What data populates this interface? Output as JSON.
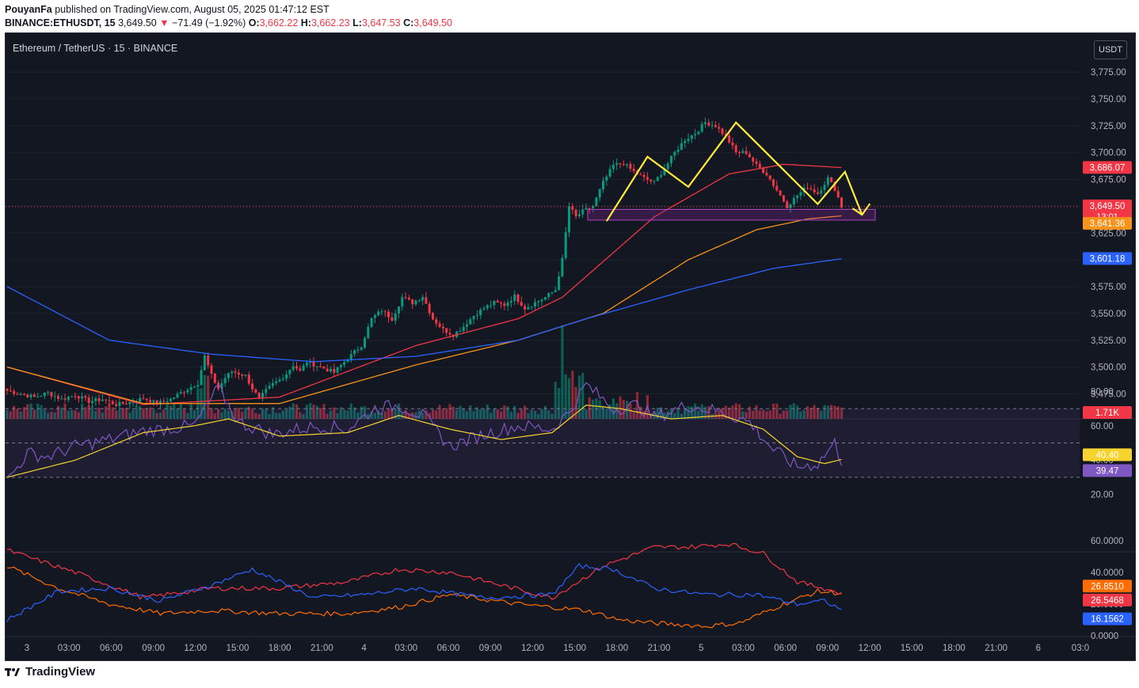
{
  "header": {
    "author": "PouyanFa",
    "published_text": "published on TradingView.com, August 05, 2025 01:47:12 EST",
    "symbol_line": "BINANCE:ETHUSDT, 15",
    "last": "3,649.50",
    "arrow": "▼",
    "change": "−71.49 (−1.92%)",
    "o_label": "O:",
    "o": "3,662.22",
    "h_label": "H:",
    "h": "3,662.23",
    "l_label": "L:",
    "l": "3,647.53",
    "c_label": "C:",
    "c": "3,649.50"
  },
  "chart": {
    "symbol_title": "Ethereum / TetherUS · 15 · BINANCE",
    "currency_button": "USDT",
    "colors": {
      "up": "#089981",
      "down": "#f23645",
      "ma_fast": "#f23645",
      "ma_mid": "#f7931a",
      "ma_slow": "#2962ff",
      "rsi": "#7e57c2",
      "rsi_ma": "#f6d32d",
      "pattern": "#ffeb3b"
    },
    "price_axis": [
      "3,775.00",
      "3,750.00",
      "3,725.00",
      "3,700.00",
      "3,675.00",
      "3,650.00",
      "3,625.00",
      "3,600.00",
      "3,575.00",
      "3,550.00",
      "3,525.00",
      "3,500.00",
      "3,475.00"
    ],
    "rsi_axis": [
      "80.00",
      "60.00",
      "40.00",
      "20.00"
    ],
    "dmi_axis": [
      "60.0000",
      "40.0000",
      "20.0000",
      "0.0000"
    ],
    "time_axis": [
      "3",
      "03:00",
      "06:00",
      "09:00",
      "12:00",
      "15:00",
      "18:00",
      "21:00",
      "4",
      "03:00",
      "06:00",
      "09:00",
      "12:00",
      "15:00",
      "18:00",
      "21:00",
      "5",
      "03:00",
      "06:00",
      "09:00",
      "12:00",
      "15:00",
      "18:00",
      "21:00",
      "6",
      "03:0"
    ],
    "price_badges": [
      {
        "label": "3,686.07",
        "color": "#f23645"
      },
      {
        "label": "3,649.50",
        "color": "#f23645",
        "sub": "13:01"
      },
      {
        "label": "3,641.36",
        "color": "#f7931a"
      },
      {
        "label": "3,601.18",
        "color": "#2962ff"
      },
      {
        "label": "1.71K",
        "color": "#f23645"
      }
    ],
    "rsi_badges": [
      {
        "label": "40.40",
        "color": "#f6d32d"
      },
      {
        "label": "39.47",
        "color": "#7e57c2"
      }
    ],
    "dmi_badges": [
      {
        "label": "26.8510",
        "color": "#ff6d00"
      },
      {
        "label": "26.5468",
        "color": "#f23645"
      },
      {
        "label": "16.1562",
        "color": "#2962ff"
      }
    ]
  },
  "chart_data": {
    "type": "candlestick",
    "title": "Ethereum / TetherUS · 15 · BINANCE",
    "ylim": [
      3462,
      3790
    ],
    "close_path": [
      [
        0,
        3478
      ],
      [
        4,
        3475
      ],
      [
        8,
        3472
      ],
      [
        12,
        3476
      ],
      [
        16,
        3470
      ],
      [
        20,
        3474
      ],
      [
        24,
        3468
      ],
      [
        28,
        3470
      ],
      [
        32,
        3465
      ],
      [
        36,
        3467
      ],
      [
        40,
        3471
      ],
      [
        44,
        3466
      ],
      [
        48,
        3470
      ],
      [
        52,
        3478
      ],
      [
        56,
        3485
      ],
      [
        58,
        3510
      ],
      [
        60,
        3492
      ],
      [
        62,
        3480
      ],
      [
        64,
        3490
      ],
      [
        66,
        3496
      ],
      [
        70,
        3492
      ],
      [
        72,
        3480
      ],
      [
        74,
        3470
      ],
      [
        76,
        3478
      ],
      [
        78,
        3484
      ],
      [
        80,
        3488
      ],
      [
        82,
        3494
      ],
      [
        84,
        3502
      ],
      [
        86,
        3496
      ],
      [
        88,
        3505
      ],
      [
        92,
        3500
      ],
      [
        96,
        3495
      ],
      [
        100,
        3508
      ],
      [
        104,
        3520
      ],
      [
        107,
        3545
      ],
      [
        110,
        3553
      ],
      [
        113,
        3545
      ],
      [
        116,
        3565
      ],
      [
        119,
        3560
      ],
      [
        122,
        3566
      ],
      [
        125,
        3545
      ],
      [
        128,
        3535
      ],
      [
        131,
        3530
      ],
      [
        134,
        3538
      ],
      [
        137,
        3548
      ],
      [
        140,
        3555
      ],
      [
        143,
        3560
      ],
      [
        146,
        3558
      ],
      [
        149,
        3566
      ],
      [
        152,
        3555
      ],
      [
        155,
        3560
      ],
      [
        158,
        3565
      ],
      [
        161,
        3572
      ],
      [
        163,
        3600
      ],
      [
        165,
        3650
      ],
      [
        167,
        3640
      ],
      [
        169,
        3645
      ],
      [
        172,
        3650
      ],
      [
        175,
        3672
      ],
      [
        178,
        3688
      ],
      [
        181,
        3690
      ],
      [
        184,
        3682
      ],
      [
        187,
        3676
      ],
      [
        190,
        3672
      ],
      [
        193,
        3685
      ],
      [
        196,
        3700
      ],
      [
        199,
        3712
      ],
      [
        202,
        3718
      ],
      [
        205,
        3728
      ],
      [
        208,
        3725
      ],
      [
        211,
        3715
      ],
      [
        214,
        3700
      ],
      [
        217,
        3700
      ],
      [
        220,
        3688
      ],
      [
        223,
        3680
      ],
      [
        226,
        3665
      ],
      [
        229,
        3650
      ],
      [
        232,
        3660
      ],
      [
        235,
        3668
      ],
      [
        238,
        3662
      ],
      [
        241,
        3676
      ],
      [
        243,
        3666
      ],
      [
        244,
        3658
      ],
      [
        245,
        3649.5
      ]
    ],
    "moving_averages": [
      {
        "name": "ma_fast",
        "color": "#f23645",
        "path": [
          [
            0,
            3500
          ],
          [
            40,
            3465
          ],
          [
            80,
            3472
          ],
          [
            120,
            3520
          ],
          [
            150,
            3545
          ],
          [
            163,
            3565
          ],
          [
            190,
            3640
          ],
          [
            212,
            3680
          ],
          [
            228,
            3689
          ],
          [
            245,
            3686
          ]
        ]
      },
      {
        "name": "ma_mid",
        "color": "#f7931a",
        "path": [
          [
            0,
            3500
          ],
          [
            40,
            3466
          ],
          [
            80,
            3466
          ],
          [
            120,
            3502
          ],
          [
            150,
            3525
          ],
          [
            175,
            3550
          ],
          [
            200,
            3600
          ],
          [
            220,
            3628
          ],
          [
            235,
            3638
          ],
          [
            245,
            3641
          ]
        ]
      },
      {
        "name": "ma_slow",
        "color": "#2962ff",
        "path": [
          [
            0,
            3575
          ],
          [
            30,
            3525
          ],
          [
            60,
            3512
          ],
          [
            90,
            3505
          ],
          [
            120,
            3510
          ],
          [
            150,
            3525
          ],
          [
            170,
            3545
          ],
          [
            200,
            3572
          ],
          [
            225,
            3592
          ],
          [
            245,
            3601
          ]
        ]
      }
    ],
    "support_zone": [
      3637,
      3647
    ],
    "last_price": 3649.5,
    "volume_last": "1.71K",
    "rsi": {
      "ylim": [
        0,
        100
      ],
      "bands": [
        30,
        50,
        70
      ],
      "value": 39.47,
      "ma_value": 40.4,
      "path": [
        [
          0,
          28
        ],
        [
          6,
          44
        ],
        [
          12,
          42
        ],
        [
          20,
          48
        ],
        [
          30,
          52
        ],
        [
          40,
          57
        ],
        [
          55,
          60
        ],
        [
          62,
          82
        ],
        [
          68,
          62
        ],
        [
          78,
          55
        ],
        [
          85,
          58
        ],
        [
          92,
          60
        ],
        [
          100,
          58
        ],
        [
          108,
          70
        ],
        [
          115,
          72
        ],
        [
          122,
          66
        ],
        [
          130,
          48
        ],
        [
          140,
          55
        ],
        [
          150,
          60
        ],
        [
          160,
          58
        ],
        [
          165,
          68
        ],
        [
          170,
          84
        ],
        [
          178,
          70
        ],
        [
          185,
          72
        ],
        [
          190,
          65
        ],
        [
          200,
          72
        ],
        [
          210,
          68
        ],
        [
          218,
          62
        ],
        [
          225,
          46
        ],
        [
          232,
          36
        ],
        [
          238,
          38
        ],
        [
          243,
          50
        ],
        [
          245,
          39.5
        ]
      ],
      "ma_path": [
        [
          0,
          30
        ],
        [
          20,
          40
        ],
        [
          40,
          56
        ],
        [
          55,
          60
        ],
        [
          65,
          64
        ],
        [
          80,
          54
        ],
        [
          100,
          56
        ],
        [
          115,
          66
        ],
        [
          130,
          58
        ],
        [
          145,
          52
        ],
        [
          160,
          56
        ],
        [
          170,
          72
        ],
        [
          180,
          70
        ],
        [
          195,
          64
        ],
        [
          210,
          66
        ],
        [
          222,
          58
        ],
        [
          232,
          42
        ],
        [
          240,
          38
        ],
        [
          245,
          40.4
        ]
      ]
    },
    "dmi": {
      "ylim": [
        0,
        60
      ],
      "series": [
        {
          "name": "orange",
          "color": "#ff6d00",
          "value": 26.851,
          "path": [
            [
              0,
              44
            ],
            [
              15,
              30
            ],
            [
              30,
              20
            ],
            [
              45,
              14
            ],
            [
              60,
              16
            ],
            [
              80,
              14
            ],
            [
              100,
              14
            ],
            [
              115,
              18
            ],
            [
              130,
              26
            ],
            [
              150,
              20
            ],
            [
              170,
              16
            ],
            [
              180,
              10
            ],
            [
              190,
              8
            ],
            [
              205,
              6
            ],
            [
              215,
              8
            ],
            [
              228,
              20
            ],
            [
              238,
              28
            ],
            [
              245,
              26.85
            ]
          ]
        },
        {
          "name": "red",
          "color": "#f23645",
          "value": 26.5468,
          "path": [
            [
              0,
              54
            ],
            [
              20,
              40
            ],
            [
              40,
              24
            ],
            [
              60,
              30
            ],
            [
              80,
              30
            ],
            [
              100,
              34
            ],
            [
              115,
              42
            ],
            [
              130,
              40
            ],
            [
              145,
              32
            ],
            [
              160,
              24
            ],
            [
              175,
              44
            ],
            [
              190,
              56
            ],
            [
              200,
              56
            ],
            [
              212,
              58
            ],
            [
              222,
              52
            ],
            [
              232,
              34
            ],
            [
              240,
              30
            ],
            [
              245,
              26.55
            ]
          ]
        },
        {
          "name": "blue",
          "color": "#2962ff",
          "value": 16.1562,
          "path": [
            [
              0,
              10
            ],
            [
              15,
              28
            ],
            [
              30,
              30
            ],
            [
              45,
              22
            ],
            [
              60,
              32
            ],
            [
              72,
              42
            ],
            [
              90,
              24
            ],
            [
              105,
              26
            ],
            [
              120,
              30
            ],
            [
              140,
              24
            ],
            [
              160,
              26
            ],
            [
              168,
              44
            ],
            [
              178,
              42
            ],
            [
              190,
              30
            ],
            [
              205,
              26
            ],
            [
              220,
              26
            ],
            [
              232,
              20
            ],
            [
              240,
              22
            ],
            [
              245,
              16.16
            ]
          ]
        }
      ]
    }
  }
}
